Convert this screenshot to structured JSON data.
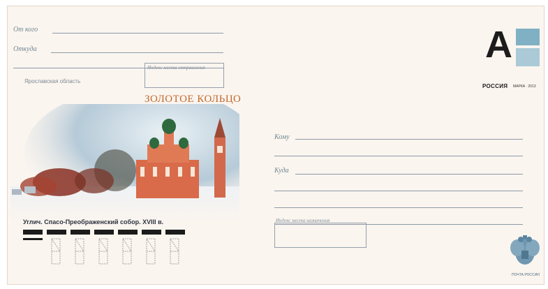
{
  "sender": {
    "from_label": "От кого",
    "where_label": "Откуда",
    "index_label": "Индекс места отправления"
  },
  "region": "Ярославская область",
  "series_title": "ЗОЛОТОЕ КОЛЬЦО",
  "photo_caption": "Углич. Спасо-Преображенский собор. XVIII в.",
  "recipient": {
    "to_label": "Кому",
    "where_label": "Куда",
    "index_label": "Индекс места назначения"
  },
  "stamp": {
    "letter": "A",
    "country": "РОССИЯ",
    "marka": "МАРКА · 2013"
  },
  "post_label": "ПОЧТА РОССИИ",
  "colors": {
    "envelope": "#fbf5ef",
    "accent_title": "#c1682c",
    "lines": "#8c9aa6"
  }
}
